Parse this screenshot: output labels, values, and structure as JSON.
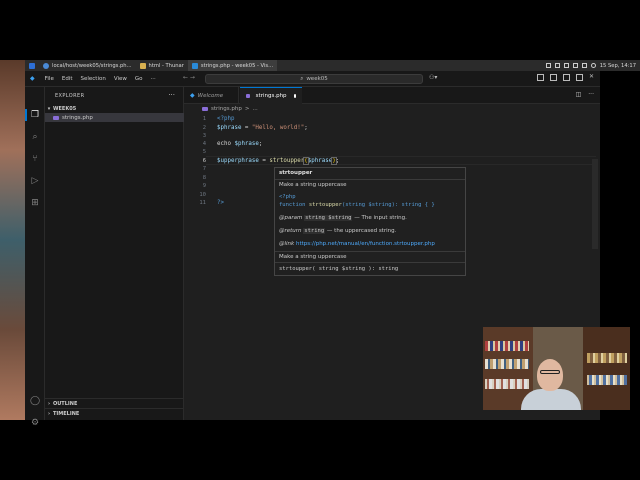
{
  "taskbar": {
    "tasks": [
      {
        "label": "local/host/week05/strings.ph..."
      },
      {
        "label": "html - Thunar"
      },
      {
        "label": "strings.php - week05 - Vis..."
      }
    ],
    "clock": "15 Sep, 14:17"
  },
  "titlebar": {
    "menus": [
      "File",
      "Edit",
      "Selection",
      "View",
      "Go"
    ],
    "more": "···",
    "search": "week05"
  },
  "sidebar": {
    "title": "EXPLORER",
    "more": "···",
    "folder": "WEEK05",
    "file": "strings.php",
    "outline": "OUTLINE",
    "timeline": "TIMELINE"
  },
  "tabs": {
    "welcome": "Welcome",
    "active": "strings.php"
  },
  "breadcrumb": {
    "file": "strings.php",
    "sep": ">",
    "more": "..."
  },
  "editor": {
    "line_numbers": [
      "1",
      "2",
      "3",
      "4",
      "5",
      "6",
      "7",
      "8",
      "9",
      "10",
      "11"
    ],
    "current_line": 6,
    "lines": {
      "l1": "<?php",
      "l2_var": "$phrase",
      "l2_op": " = ",
      "l2_str": "\"Hello, world!\"",
      "l2_end": ";",
      "l4_kw": "echo",
      "l4_var": " $phrase",
      "l4_end": ";",
      "l6_var": "$upperphrase",
      "l6_op": " = ",
      "l6_fn": "strtoupper",
      "l6_open": "(",
      "l6_arg": "$phrase",
      "l6_close": ")",
      "l6_end": ";",
      "l11": "?>"
    }
  },
  "hover": {
    "title": "strtoupper",
    "summary": "Make a string uppercase",
    "sig_tag": "<?php",
    "sig_kw": "function",
    "sig_fn": "strtoupper",
    "sig_rest": "(string $string): string { }",
    "param_tag": "@param",
    "param_code": "string $string",
    "param_desc": "— The input string.",
    "return_tag": "@return",
    "return_code": "string",
    "return_desc": "— the uppercased string.",
    "link_tag": "@link",
    "link_url": "https://php.net/manual/en/function.strtoupper.php",
    "summary2": "Make a string uppercase",
    "signature": "strtoupper( string $string ): string"
  },
  "colors": {
    "editor_bg": "#1f1f1f",
    "sidebar_bg": "#181818",
    "accent": "#0078d4",
    "keyword": "#569cd6",
    "variable": "#9cdcfe",
    "string": "#ce9178",
    "function": "#dcdcaa",
    "link": "#4daafc"
  }
}
